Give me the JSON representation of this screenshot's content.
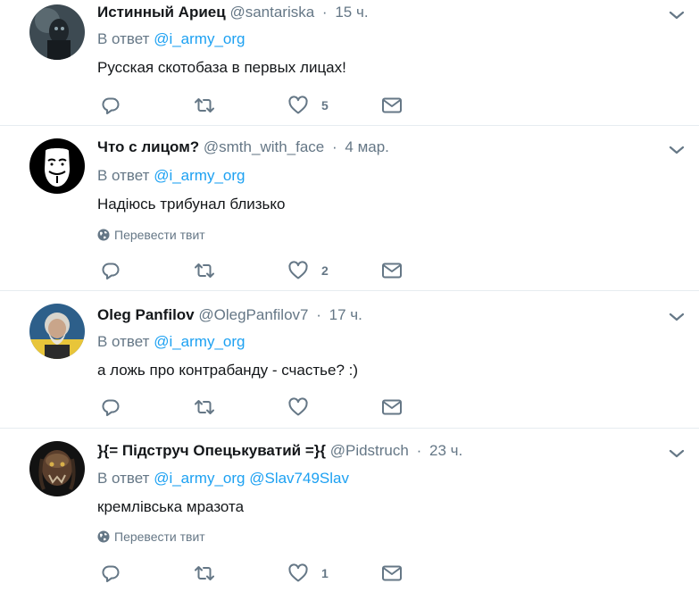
{
  "reply_prefix": "В ответ",
  "translate_label": "Перевести твит",
  "colors": {
    "link": "#1da1f2",
    "muted": "#657786",
    "divider": "#e6ecf0",
    "text": "#14171a"
  },
  "tweets": [
    {
      "name": "Истинный Ариец",
      "handle": "@santariska",
      "time": "15 ч.",
      "reply_to": [
        "@i_army_org"
      ],
      "text": "Русская скотобаза в первых лицах!",
      "likes": "5",
      "avatar": "dark-figure-avatar"
    },
    {
      "name": "Что с лицом?",
      "handle": "@smth_with_face",
      "time": "4 мар.",
      "reply_to": [
        "@i_army_org"
      ],
      "text": "Надіюсь трибунал близько",
      "likes": "2",
      "avatar": "guy-fawkes-mask-avatar"
    },
    {
      "name": "Oleg Panfilov",
      "handle": "@OlegPanfilov7",
      "time": "17 ч.",
      "reply_to": [
        "@i_army_org"
      ],
      "text": "а ложь про контрабанду - счастье? :)",
      "likes": "",
      "avatar": "bearded-man-avatar"
    },
    {
      "name": "}{= Підструч Опецькуватий =}{",
      "handle": "@Pidstruch",
      "time": "23 ч.",
      "reply_to": [
        "@i_army_org",
        "@Slav749Slav"
      ],
      "text": "кремлівська мразота",
      "likes": "1",
      "avatar": "predator-avatar"
    }
  ]
}
